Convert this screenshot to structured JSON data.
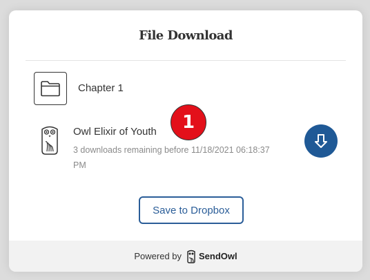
{
  "dialog": {
    "title": "File Download"
  },
  "folder": {
    "label": "Chapter 1",
    "icon": "folder-icon"
  },
  "product": {
    "name": "Owl Elixir of Youth",
    "remaining": "3 downloads remaining before 11/18/2021 06:18:37 PM",
    "icon": "owl-icon"
  },
  "annotation": {
    "badge": "1",
    "color": "#e3101a"
  },
  "download_button": {
    "icon": "download-arrow-icon",
    "color": "#1f5996"
  },
  "dropbox": {
    "label": "Save to Dropbox"
  },
  "footer": {
    "powered_by": "Powered by",
    "brand": "SendOwl",
    "brand_icon": "sendowl-logo-icon"
  }
}
